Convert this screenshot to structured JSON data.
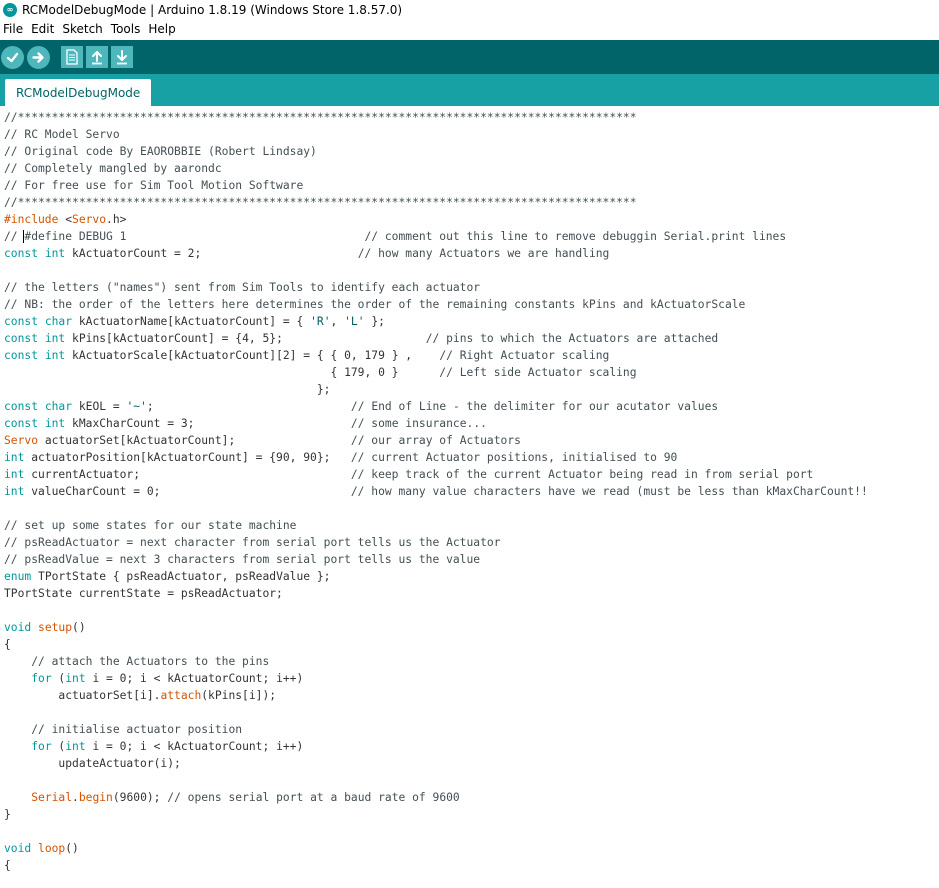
{
  "window": {
    "title": "RCModelDebugMode | Arduino 1.8.19 (Windows Store 1.8.57.0)",
    "app_icon": "arduino-infinity-icon"
  },
  "menu": [
    "File",
    "Edit",
    "Sketch",
    "Tools",
    "Help"
  ],
  "toolbar": {
    "buttons": [
      {
        "name": "verify",
        "icon": "check-icon"
      },
      {
        "name": "upload",
        "icon": "arrow-right-icon"
      },
      {
        "name": "new",
        "icon": "document-icon"
      },
      {
        "name": "open",
        "icon": "arrow-up-icon"
      },
      {
        "name": "save",
        "icon": "arrow-down-icon"
      }
    ],
    "background": "#006468",
    "button_color": "#4db7bb"
  },
  "tabs": [
    {
      "label": "RCModelDebugMode",
      "active": true
    }
  ],
  "colors": {
    "keyword": "#00979c",
    "function": "#d35400",
    "comment": "#434f54",
    "tab_strip": "#17a1a5"
  },
  "editor": {
    "lines": [
      "//*******************************************************************************************",
      "// RC Model Servo",
      "// Original code By EAOROBBIE (Robert Lindsay)",
      "// Completely mangled by aarondc",
      "// For free use for Sim Tool Motion Software",
      "//*******************************************************************************************",
      "#include <Servo.h>",
      "// #define DEBUG 1                                   // comment out this line to remove debuggin Serial.print lines",
      "const int kActuatorCount = 2;                       // how many Actuators we are handling",
      "",
      "// the letters (\"names\") sent from Sim Tools to identify each actuator",
      "// NB: the order of the letters here determines the order of the remaining constants kPins and kActuatorScale",
      "const char kActuatorName[kActuatorCount] = { 'R', 'L' };",
      "const int kPins[kActuatorCount] = {4, 5};                     // pins to which the Actuators are attached",
      "const int kActuatorScale[kActuatorCount][2] = { { 0, 179 } ,    // Right Actuator scaling",
      "                                                { 179, 0 }      // Left side Actuator scaling",
      "                                              };",
      "const char kEOL = '~';                             // End of Line - the delimiter for our acutator values",
      "const int kMaxCharCount = 3;                       // some insurance...",
      "Servo actuatorSet[kActuatorCount];                 // our array of Actuators",
      "int actuatorPosition[kActuatorCount] = {90, 90};   // current Actuator positions, initialised to 90",
      "int currentActuator;                               // keep track of the current Actuator being read in from serial port",
      "int valueCharCount = 0;                            // how many value characters have we read (must be less than kMaxCharCount!!",
      "",
      "// set up some states for our state machine",
      "// psReadActuator = next character from serial port tells us the Actuator",
      "// psReadValue = next 3 characters from serial port tells us the value",
      "enum TPortState { psReadActuator, psReadValue };",
      "TPortState currentState = psReadActuator;",
      "",
      "void setup()",
      "{",
      "    // attach the Actuators to the pins",
      "    for (int i = 0; i < kActuatorCount; i++)",
      "        actuatorSet[i].attach(kPins[i]);",
      "",
      "    // initialise actuator position",
      "    for (int i = 0; i < kActuatorCount; i++)",
      "        updateActuator(i);",
      "",
      "    Serial.begin(9600); // opens serial port at a baud rate of 9600",
      "}",
      "",
      "void loop()",
      "{"
    ]
  }
}
